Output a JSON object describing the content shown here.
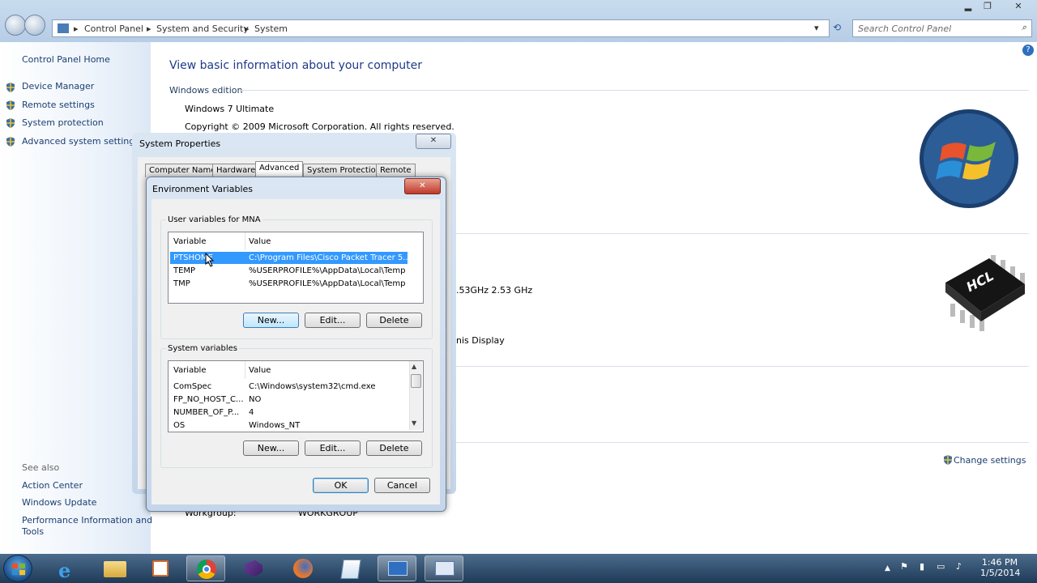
{
  "window": {
    "minimize": "▂",
    "maximize": "❐",
    "close": "✕"
  },
  "address": {
    "crumbs": [
      "Control Panel",
      "System and Security",
      "System"
    ],
    "separator": "▸",
    "search_placeholder": "Search Control Panel"
  },
  "sidebar": {
    "home": "Control Panel Home",
    "items": [
      {
        "label": "Device Manager"
      },
      {
        "label": "Remote settings"
      },
      {
        "label": "System protection"
      },
      {
        "label": "Advanced system settings"
      }
    ],
    "see_also_title": "See also",
    "see_also": [
      "Action Center",
      "Windows Update",
      "Performance Information and",
      "Tools"
    ]
  },
  "main": {
    "heading": "View basic information about your computer",
    "edition_title": "Windows edition",
    "edition": "Windows 7 Ultimate",
    "copyright": "Copyright © 2009 Microsoft Corporation.  All rights reserved.",
    "processor_fragment": ".53GHz   2.53 GHz",
    "display_fragment": "nis Display",
    "change_settings": "Change settings",
    "workgroup_label": "Workgroup:",
    "workgroup_value": "WORKGROUP",
    "help": "?"
  },
  "system_properties": {
    "title": "System Properties",
    "close": "✕",
    "tabs": [
      "Computer Name",
      "Hardware",
      "Advanced",
      "System Protection",
      "Remote"
    ],
    "active_tab": "Advanced"
  },
  "env_vars": {
    "title": "Environment Variables",
    "close": "✕",
    "user_group": "User variables for MNA",
    "col_variable": "Variable",
    "col_value": "Value",
    "user_vars": [
      {
        "name": "PTSHOME",
        "value": "C:\\Program Files\\Cisco Packet Tracer 5...."
      },
      {
        "name": "TEMP",
        "value": "%USERPROFILE%\\AppData\\Local\\Temp"
      },
      {
        "name": "TMP",
        "value": "%USERPROFILE%\\AppData\\Local\\Temp"
      }
    ],
    "user_buttons": {
      "new": "New...",
      "edit": "Edit...",
      "delete": "Delete"
    },
    "system_group": "System variables",
    "system_vars": [
      {
        "name": "ComSpec",
        "value": "C:\\Windows\\system32\\cmd.exe"
      },
      {
        "name": "FP_NO_HOST_C...",
        "value": "NO"
      },
      {
        "name": "NUMBER_OF_P...",
        "value": "4"
      },
      {
        "name": "OS",
        "value": "Windows_NT"
      }
    ],
    "system_buttons": {
      "new": "New...",
      "edit": "Edit...",
      "delete": "Delete"
    },
    "ok": "OK",
    "cancel": "Cancel"
  },
  "taskbar": {
    "time": "1:46 PM",
    "date": "1/5/2014",
    "apps": [
      "start-orb",
      "internet-explorer-icon",
      "file-explorer-icon",
      "media-player-icon",
      "chrome-icon",
      "visual-studio-icon",
      "firefox-icon",
      "notepad-icon",
      "control-panel-icon",
      "system-properties-icon"
    ]
  },
  "colors": {
    "link": "#1a3e72",
    "heading": "#1e3a8a",
    "selection": "#3399ff"
  }
}
